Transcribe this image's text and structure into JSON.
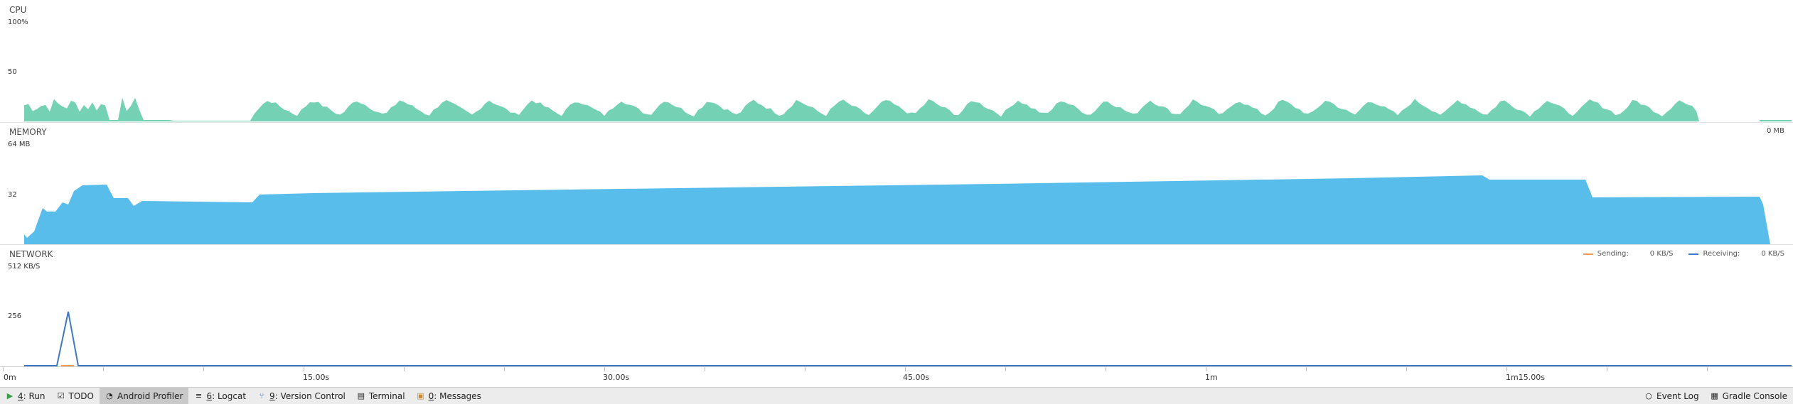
{
  "cpu": {
    "label": "CPU",
    "max_label": "100%",
    "mid_label": "50",
    "color": "#74d1b4"
  },
  "memory": {
    "label": "MEMORY",
    "max_label": "64 MB",
    "mid_label": "32",
    "right_value": "0 MB",
    "color": "#58bdea"
  },
  "network": {
    "label": "NETWORK",
    "max_label": "512 KB/S",
    "mid_label": "256",
    "sending_label": "Sending:",
    "sending_value": "0 KB/S",
    "sending_color": "#f19a58",
    "receiving_label": "Receiving:",
    "receiving_value": "0 KB/S",
    "receiving_color": "#3f78c3"
  },
  "timeline": {
    "ticks": [
      "0m",
      "15.00s",
      "30.00s",
      "45.00s",
      "1m",
      "1m15.00s"
    ]
  },
  "toolbar": {
    "run": {
      "key": "4",
      "label": ": Run"
    },
    "todo": {
      "label": "TODO"
    },
    "profiler": {
      "label": "Android Profiler"
    },
    "logcat": {
      "key": "6",
      "label": ": Logcat"
    },
    "vcs": {
      "key": "9",
      "label": ": Version Control"
    },
    "terminal": {
      "label": "Terminal"
    },
    "messages": {
      "key": "0",
      "label": ": Messages"
    },
    "event_log": {
      "label": "Event Log"
    },
    "gradle": {
      "label": "Gradle Console"
    }
  }
}
